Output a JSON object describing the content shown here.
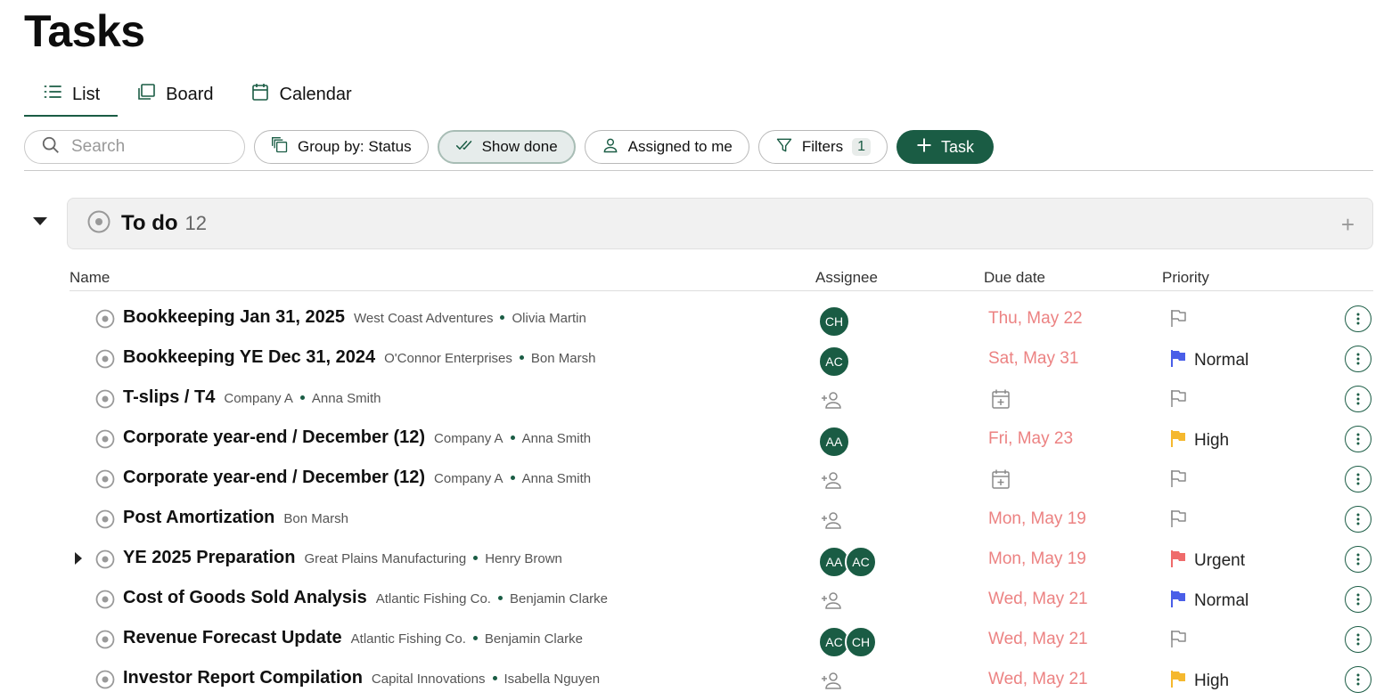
{
  "page": {
    "title": "Tasks"
  },
  "tabs": [
    {
      "label": "List",
      "icon": "list-icon",
      "active": true
    },
    {
      "label": "Board",
      "icon": "board-icon"
    },
    {
      "label": "Calendar",
      "icon": "calendar-icon"
    }
  ],
  "toolbar": {
    "search_placeholder": "Search",
    "group_by_label": "Group by: Status",
    "show_done_label": "Show done",
    "assigned_label": "Assigned to me",
    "filters_label": "Filters",
    "filters_count": "1",
    "add_task_label": "Task"
  },
  "group": {
    "name": "To do",
    "count": "12",
    "add_symbol": "+"
  },
  "columns": {
    "name": "Name",
    "assignee": "Assignee",
    "due": "Due date",
    "priority": "Priority"
  },
  "colors": {
    "accent": "#1a5c44",
    "due": "#ec8282",
    "normal": "#4a5ee8",
    "high": "#f5b82e",
    "urgent": "#ef6b6b"
  },
  "tasks": [
    {
      "name": "Bookkeeping Jan 31, 2025",
      "client": "West Coast Adventures",
      "person": "Olivia Martin",
      "assignees": [
        "CH"
      ],
      "due": "Thu, May 22",
      "priority": "",
      "priority_color": "",
      "expandable": false
    },
    {
      "name": "Bookkeeping YE Dec 31, 2024",
      "client": "O'Connor Enterprises",
      "person": "Bon Marsh",
      "assignees": [
        "AC"
      ],
      "due": "Sat, May 31",
      "priority": "Normal",
      "priority_color": "#4a5ee8",
      "expandable": false
    },
    {
      "name": "T-slips / T4",
      "client": "Company A",
      "person": "Anna Smith",
      "assignees": [],
      "due": "",
      "priority": "",
      "priority_color": "",
      "expandable": false
    },
    {
      "name": "Corporate year-end / December (12)",
      "client": "Company A",
      "person": "Anna Smith",
      "assignees": [
        "AA"
      ],
      "due": "Fri, May 23",
      "priority": "High",
      "priority_color": "#f5b82e",
      "expandable": false
    },
    {
      "name": "Corporate year-end / December (12)",
      "client": "Company A",
      "person": "Anna Smith",
      "assignees": [],
      "due": "",
      "priority": "",
      "priority_color": "",
      "expandable": false
    },
    {
      "name": "Post Amortization",
      "client": "",
      "person": "Bon Marsh",
      "assignees": [],
      "due": "Mon, May 19",
      "priority": "",
      "priority_color": "",
      "expandable": false
    },
    {
      "name": "YE 2025 Preparation",
      "client": "Great Plains Manufacturing",
      "person": "Henry Brown",
      "assignees": [
        "AA",
        "AC"
      ],
      "due": "Mon, May 19",
      "priority": "Urgent",
      "priority_color": "#ef6b6b",
      "expandable": true
    },
    {
      "name": "Cost of Goods Sold Analysis",
      "client": "Atlantic Fishing Co.",
      "person": "Benjamin Clarke",
      "assignees": [],
      "due": "Wed, May 21",
      "priority": "Normal",
      "priority_color": "#4a5ee8",
      "expandable": false
    },
    {
      "name": "Revenue Forecast Update",
      "client": "Atlantic Fishing Co.",
      "person": "Benjamin Clarke",
      "assignees": [
        "AC",
        "CH"
      ],
      "due": "Wed, May 21",
      "priority": "",
      "priority_color": "",
      "expandable": false
    },
    {
      "name": "Investor Report Compilation",
      "client": "Capital Innovations",
      "person": "Isabella Nguyen",
      "assignees": [],
      "due": "Wed, May 21",
      "priority": "High",
      "priority_color": "#f5b82e",
      "expandable": false
    }
  ]
}
